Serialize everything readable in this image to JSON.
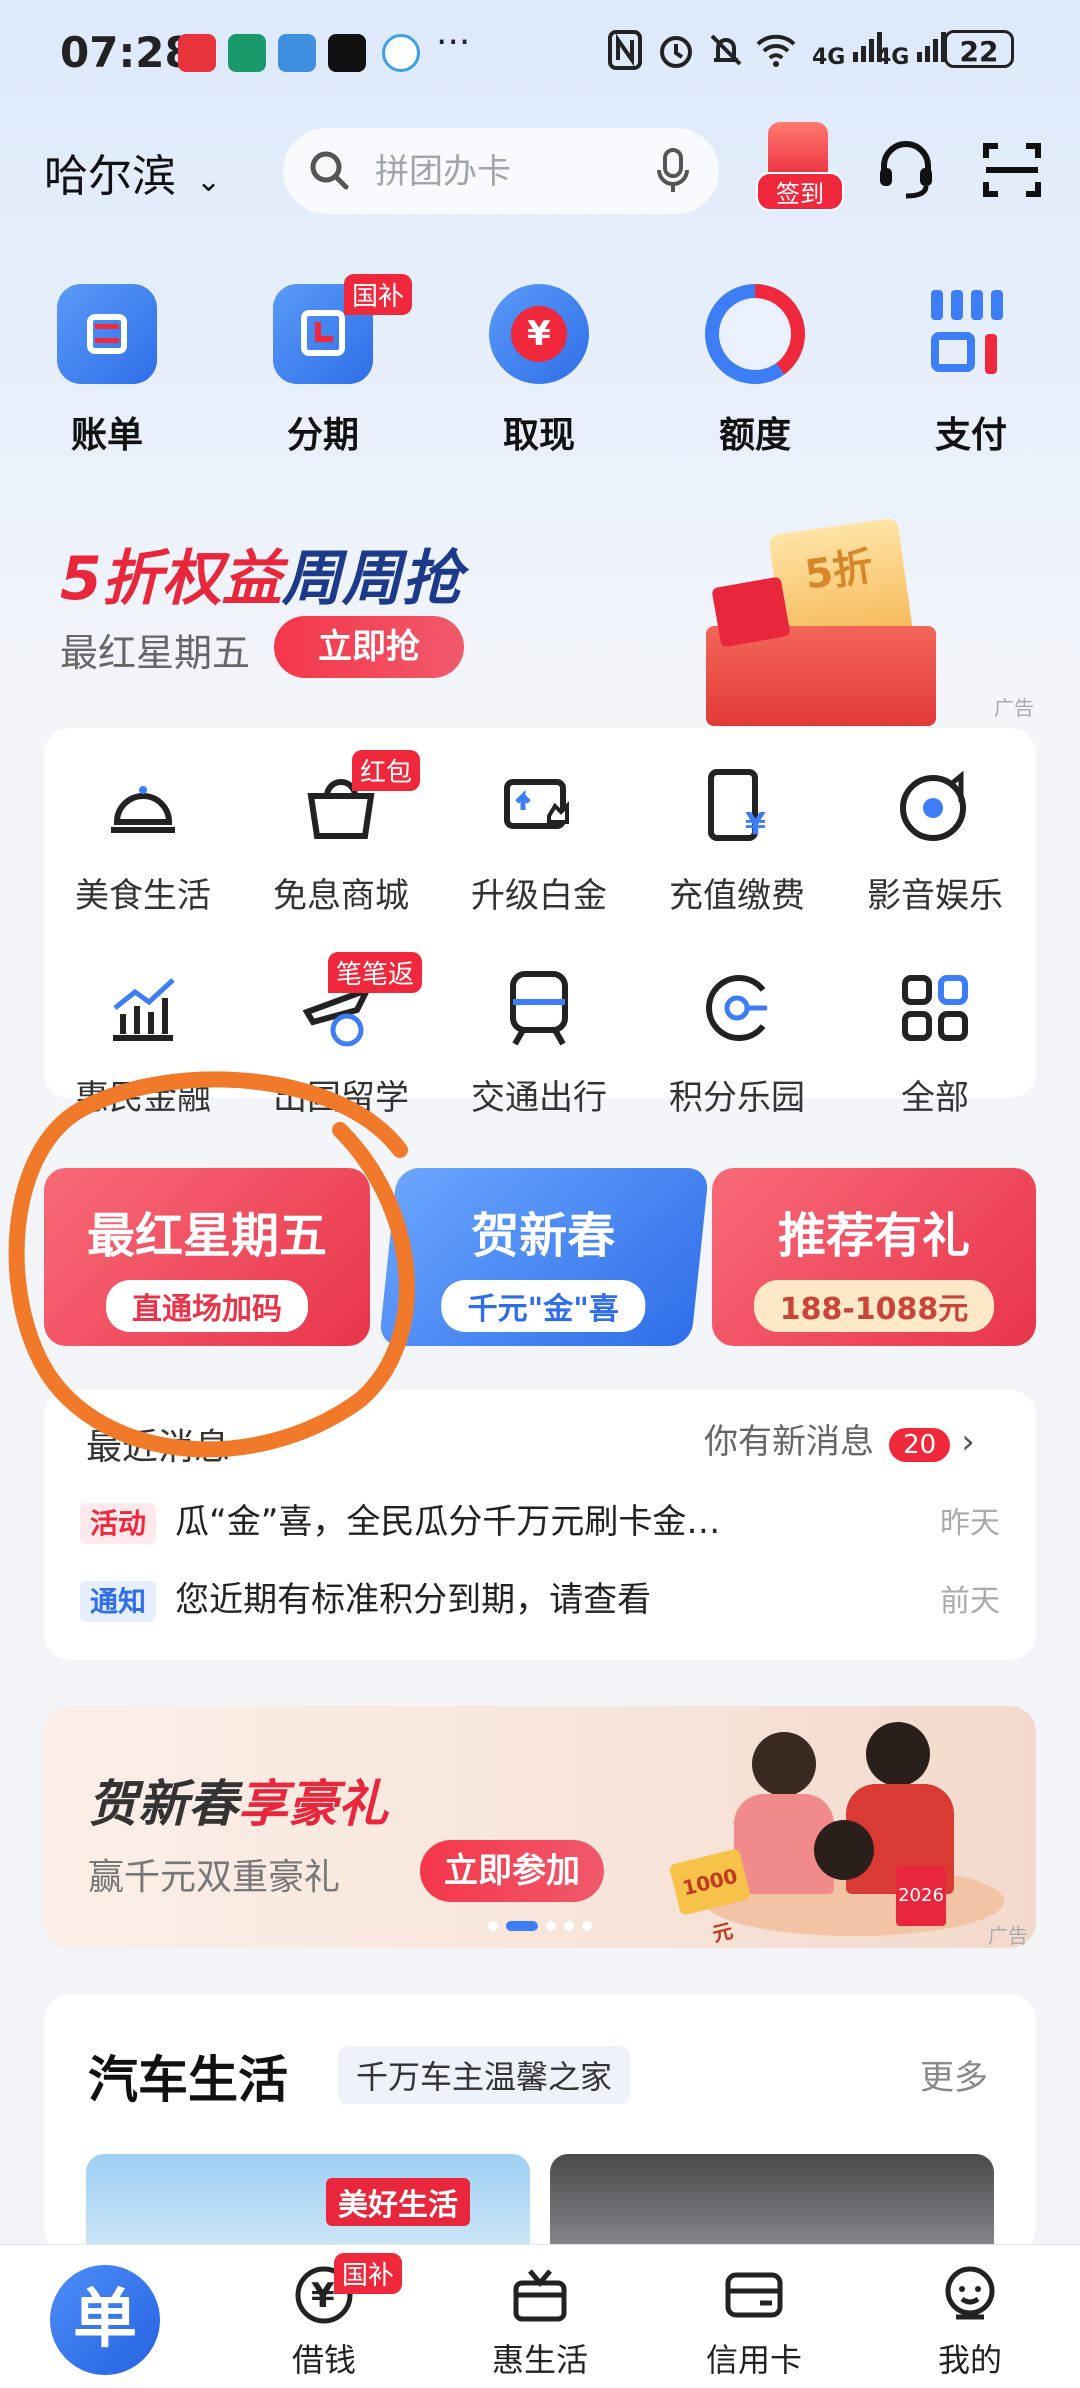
{
  "status_bar": {
    "time": "07:28",
    "more": "···",
    "net1": "4G",
    "net2": "4G",
    "battery": "22"
  },
  "header": {
    "city": "哈尔滨",
    "search_placeholder": "拼团办卡",
    "checkin_label": "签到"
  },
  "shortcuts": [
    {
      "label": "账单",
      "icon": "bill-icon"
    },
    {
      "label": "分期",
      "icon": "installment-icon",
      "tag": "国补"
    },
    {
      "label": "取现",
      "icon": "cash-icon"
    },
    {
      "label": "额度",
      "icon": "credit-limit-icon"
    },
    {
      "label": "支付",
      "icon": "pay-icon"
    }
  ],
  "banner": {
    "title_part1": "5折权益",
    "title_part2": "周周抢",
    "subtitle": "最红星期五",
    "button": "立即抢",
    "badge": "5折",
    "ad_label": "广告"
  },
  "grid": [
    {
      "label": "美食生活",
      "icon": "food-bell-icon"
    },
    {
      "label": "免息商城",
      "icon": "mall-basket-icon",
      "tag": "红包"
    },
    {
      "label": "升级白金",
      "icon": "upgrade-card-icon"
    },
    {
      "label": "充值缴费",
      "icon": "recharge-icon"
    },
    {
      "label": "影音娱乐",
      "icon": "media-icon"
    },
    {
      "label": "惠民金融",
      "icon": "finance-chart-icon"
    },
    {
      "label": "出国留学",
      "icon": "study-abroad-icon",
      "tag": "笔笔返"
    },
    {
      "label": "交通出行",
      "icon": "transit-icon"
    },
    {
      "label": "积分乐园",
      "icon": "points-icon"
    },
    {
      "label": "全部",
      "icon": "all-grid-icon"
    }
  ],
  "tiles": [
    {
      "title": "最红星期五",
      "sub": "直通场加码",
      "color": "#f0445a"
    },
    {
      "title": "贺新春",
      "sub": "千元\"金\"喜",
      "color": "#3d7df5"
    },
    {
      "title": "推荐有礼",
      "sub": "188-1088元",
      "color": "#f0445a"
    }
  ],
  "messages": {
    "title": "最近消息",
    "new_label": "你有新消息",
    "count": "20",
    "items": [
      {
        "tag": "活动",
        "text": "瓜“金”喜，全民瓜分千万元刷卡金…",
        "time": "昨天"
      },
      {
        "tag": "通知",
        "text": "您近期有标准积分到期，请查看",
        "time": "前天"
      }
    ]
  },
  "ad": {
    "title1": "贺新春",
    "title2": "享豪礼",
    "subtitle": "赢千元双重豪礼",
    "button": "立即参加",
    "ad_label": "广告",
    "sign": "2026",
    "prize": "1000元"
  },
  "car": {
    "title": "汽车生活",
    "subtitle": "千万车主温馨之家",
    "more": "更多",
    "card_label": "美好生活"
  },
  "nav": [
    {
      "label": "",
      "icon": "home-logo-icon"
    },
    {
      "label": "借钱",
      "icon": "loan-icon",
      "tag": "国补"
    },
    {
      "label": "惠生活",
      "icon": "life-gift-icon"
    },
    {
      "label": "信用卡",
      "icon": "credit-card-icon"
    },
    {
      "label": "我的",
      "icon": "profile-icon"
    }
  ],
  "colors": {
    "brand_red": "#f0283c",
    "brand_blue": "#3d7df5",
    "annotation_orange": "#f07a2a"
  }
}
